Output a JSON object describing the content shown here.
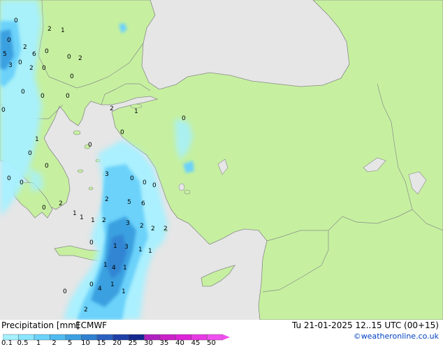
{
  "legend": {
    "title": "Precipitation [mm]",
    "model": "ECMWF",
    "thresholds": [
      "0.1",
      "0.5",
      "1",
      "2",
      "5",
      "10",
      "15",
      "20",
      "25",
      "30",
      "35",
      "40",
      "45",
      "50"
    ],
    "colors": [
      "#a6f0ff",
      "#8ae6ff",
      "#6cd2fa",
      "#4fbbf0",
      "#3ba0e0",
      "#2f80d0",
      "#2a60c0",
      "#1f3fa8",
      "#142890",
      "#b020c0",
      "#cc20c8",
      "#dd22d8",
      "#e838e4",
      "#f050f0"
    ]
  },
  "valid_time": "Tu 21-01-2025 12..15 UTC (00+15)",
  "credit": "©weatheronline.co.uk",
  "colors": {
    "land": "#c6f0a0",
    "sea": "#e6e6e6",
    "border": "#8a8a8a"
  },
  "map_labels": {
    "black_sea": [
      "0",
      "2",
      "1",
      "0",
      "5",
      "2",
      "6",
      "0",
      "0",
      "3",
      "2",
      "0",
      "2",
      "0",
      "0",
      "0",
      "0",
      "0"
    ],
    "aegean": [
      "0",
      "2",
      "1",
      "0",
      "0",
      "0",
      "1",
      "0",
      "0",
      "3",
      "0",
      "2",
      "1",
      "0",
      "0",
      "2",
      "0",
      "5",
      "6",
      "0",
      "3",
      "2",
      "2",
      "2",
      "1",
      "0",
      "1",
      "3",
      "1",
      "1",
      "1",
      "4",
      "0",
      "1",
      "4",
      "1",
      "2",
      "0",
      "2",
      "1",
      "1",
      "0"
    ]
  }
}
